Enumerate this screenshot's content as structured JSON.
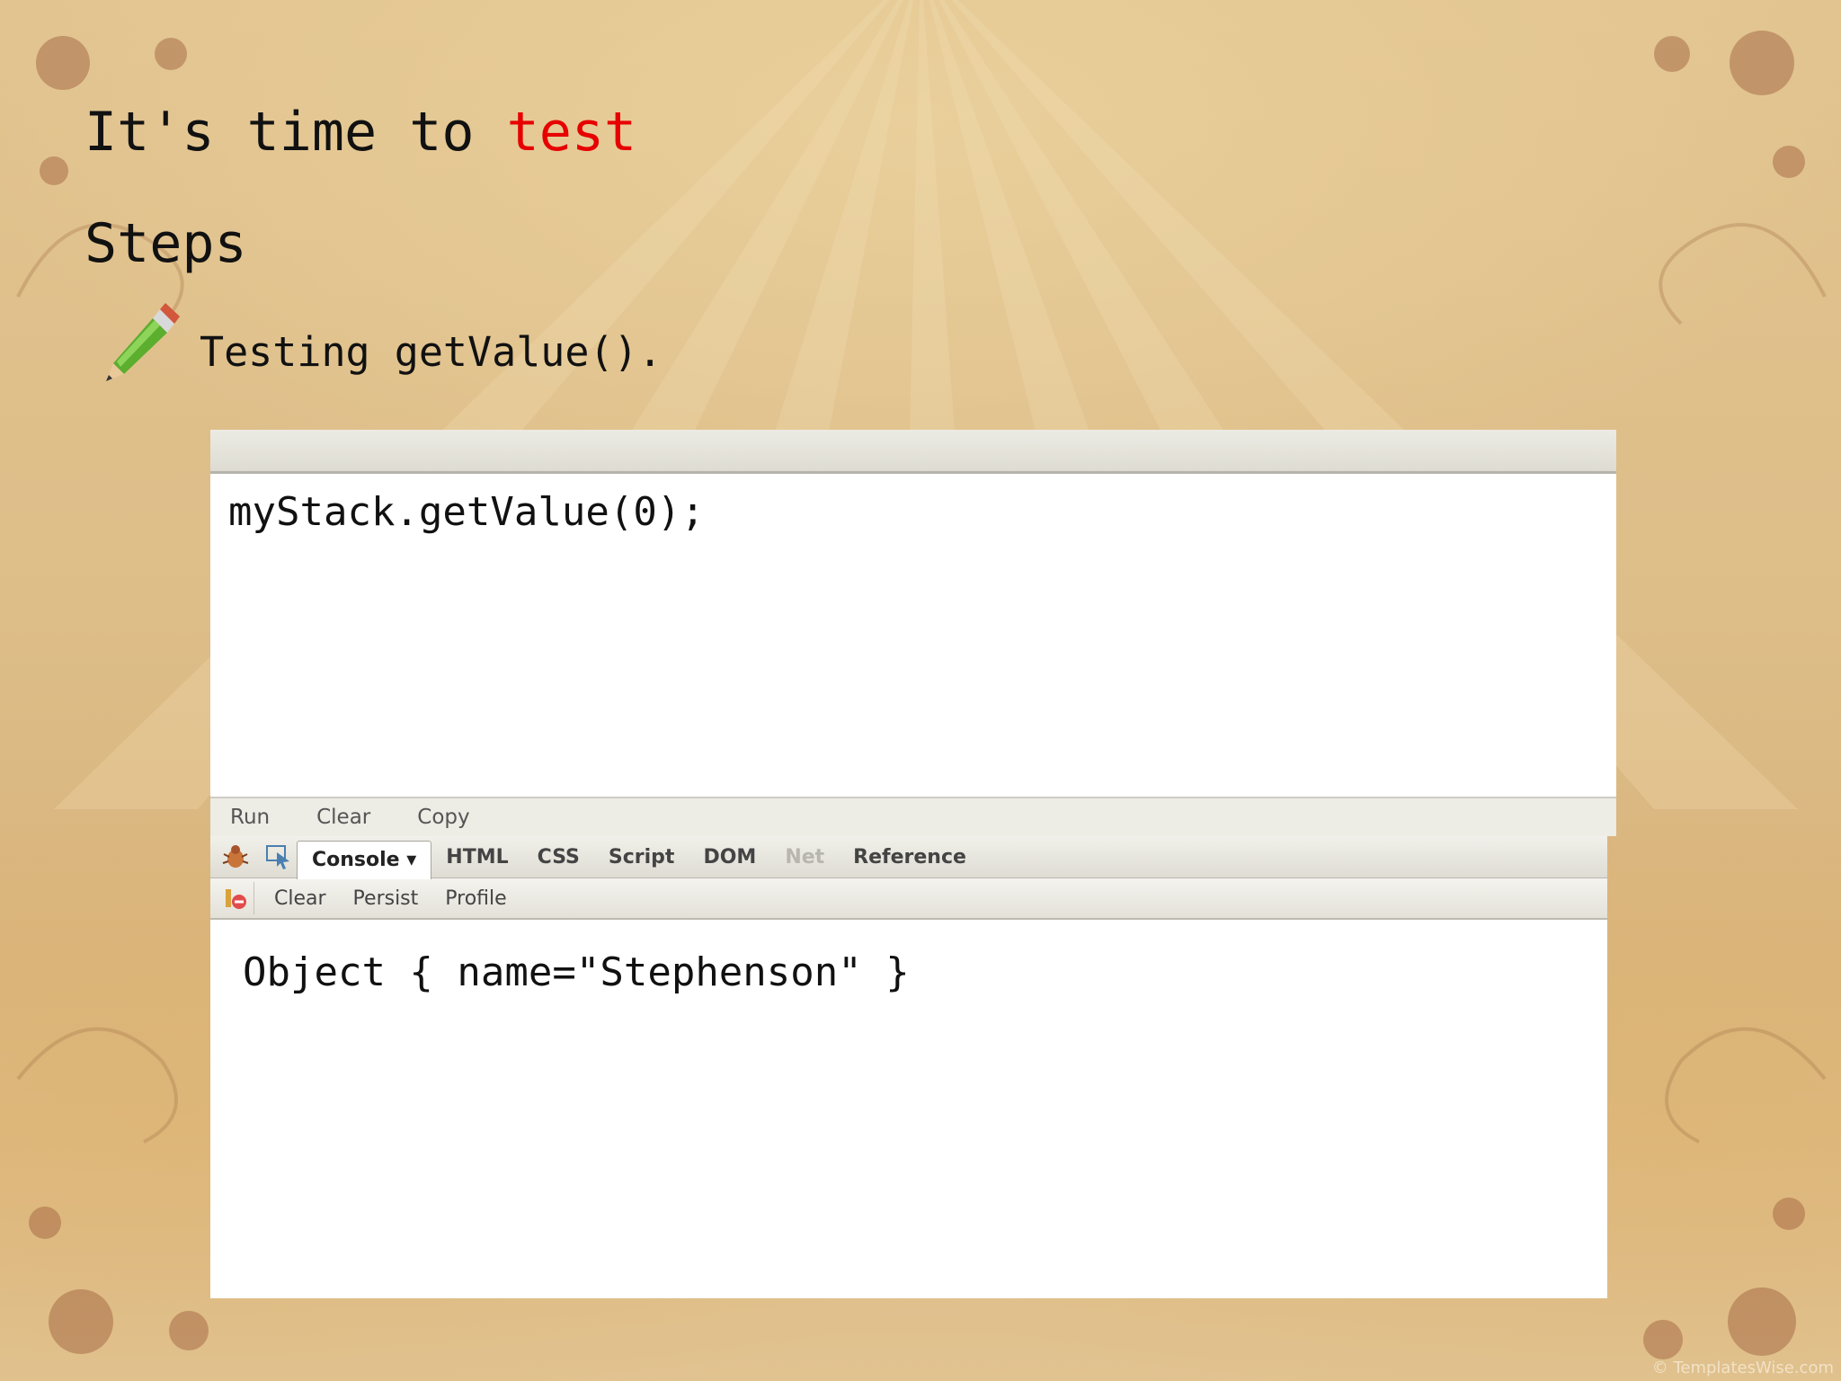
{
  "slide": {
    "title_prefix": "It's time to ",
    "title_highlight": "test",
    "heading": "Steps",
    "bullet_text": "Testing getValue()."
  },
  "editor": {
    "code": "myStack.getValue(0);",
    "buttons": [
      "Run",
      "Clear",
      "Copy"
    ]
  },
  "firebug": {
    "tabs": [
      "Console ▾",
      "HTML",
      "CSS",
      "Script",
      "DOM",
      "Net",
      "Reference"
    ],
    "active_tab": "Console ▾",
    "toolbar": [
      "Clear",
      "Persist",
      "Profile"
    ],
    "output": "Object { name=\"Stephenson\" }"
  },
  "watermark": "© TemplatesWise.com",
  "colors": {
    "highlight": "#e60000",
    "background": "#e2c490"
  },
  "icons": [
    "pencil-bullet-icon",
    "firebug-icon",
    "inspect-icon",
    "clear-console-icon"
  ]
}
